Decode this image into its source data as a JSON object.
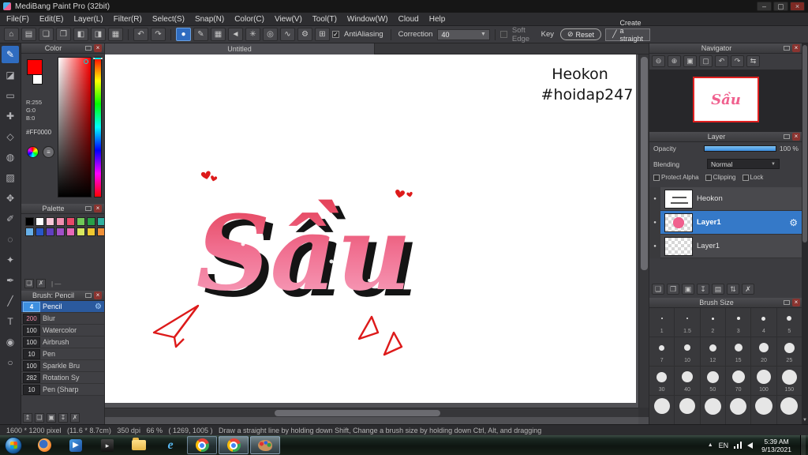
{
  "window": {
    "title": "MediBang Paint Pro (32bit)"
  },
  "menu": {
    "items": [
      "File(F)",
      "Edit(E)",
      "Layer(L)",
      "Filter(R)",
      "Select(S)",
      "Snap(N)",
      "Color(C)",
      "View(V)",
      "Tool(T)",
      "Window(W)",
      "Cloud",
      "Help"
    ]
  },
  "toolbar": {
    "antialiasing": "AntiAliasing",
    "correction_label": "Correction",
    "correction_value": "40",
    "soft_edge": "Soft Edge",
    "key_label": "Key",
    "reset_label": "Reset",
    "straight_line": "Create a straight line"
  },
  "color_panel": {
    "title": "Color",
    "r": "R:255",
    "g": "G:0",
    "b": "B:0",
    "hex": "#FF0000",
    "foreground": "#ff0000"
  },
  "palette_panel": {
    "title": "Palette",
    "swatches": [
      "#000000",
      "#ffffff",
      "#f8c8d8",
      "#f090b0",
      "#e84868",
      "#70c858",
      "#28a048",
      "#30b0a0",
      "#68b0e8",
      "#2858c8",
      "#6040c0",
      "#a050c8",
      "#e868b8",
      "#d8e860",
      "#f0c830",
      "#f09038"
    ]
  },
  "brush_panel": {
    "title": "Brush: Pencil",
    "brushes": [
      {
        "size": "4",
        "name": "Pencil"
      },
      {
        "size": "200",
        "name": "Blur"
      },
      {
        "size": "100",
        "name": "Watercolor"
      },
      {
        "size": "100",
        "name": "Airbrush"
      },
      {
        "size": "10",
        "name": "Pen"
      },
      {
        "size": "100",
        "name": "Sparkle Bru"
      },
      {
        "size": "282",
        "name": "Rotation Sy"
      },
      {
        "size": "10",
        "name": "Pen (Sharp"
      }
    ]
  },
  "canvas": {
    "tab": "Untitled",
    "signature1": "Heokon",
    "signature2": "#hoidap247",
    "lettering": "Sầu"
  },
  "navigator": {
    "title": "Navigator"
  },
  "layers": {
    "title": "Layer",
    "opacity_label": "Opacity",
    "opacity_value": "100 %",
    "blending_label": "Blending",
    "blending_value": "Normal",
    "protect_alpha": "Protect Alpha",
    "clipping": "Clipping",
    "lock": "Lock",
    "items": [
      {
        "name": "Heokon"
      },
      {
        "name": "Layer1"
      },
      {
        "name": "Layer1"
      }
    ]
  },
  "brush_size": {
    "title": "Brush Size",
    "sizes": [
      "1",
      "1.5",
      "2",
      "3",
      "4",
      "5",
      "7",
      "10",
      "12",
      "15",
      "20",
      "25",
      "30",
      "40",
      "50",
      "70",
      "100",
      "150"
    ]
  },
  "status": {
    "text": "1600 * 1200 pixel   (11.6 * 8.7cm)   350 dpi   66 %   ( 1269, 1005 )   Draw a straight line by holding down Shift, Change a brush size by holding down Ctrl, Alt, and dragging"
  },
  "taskbar": {
    "lang": "EN",
    "time": "5:39 AM",
    "date": "9/13/2021"
  },
  "colors": {
    "accent_blue": "#3d8fe0",
    "selection_blue": "#3579c8",
    "art_pink": "#f0608e",
    "art_red": "#dd1a1a",
    "nav_border_red": "#e02020"
  }
}
